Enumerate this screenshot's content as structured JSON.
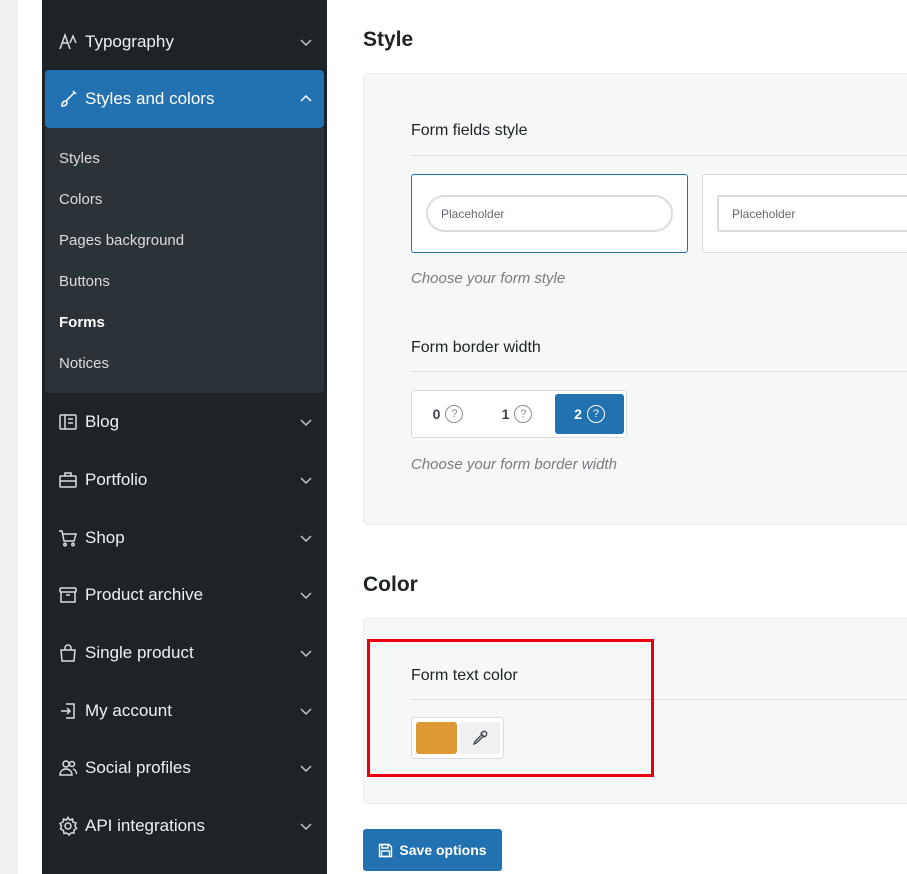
{
  "sidebar": {
    "items": [
      {
        "label": "Typography",
        "icon": "typography-icon"
      },
      {
        "label": "Styles and colors",
        "icon": "brush-icon"
      },
      {
        "label": "Blog",
        "icon": "blog-icon"
      },
      {
        "label": "Portfolio",
        "icon": "briefcase-icon"
      },
      {
        "label": "Shop",
        "icon": "cart-icon"
      },
      {
        "label": "Product archive",
        "icon": "archive-icon"
      },
      {
        "label": "Single product",
        "icon": "bag-icon"
      },
      {
        "label": "My account",
        "icon": "login-icon"
      },
      {
        "label": "Social profiles",
        "icon": "users-icon"
      },
      {
        "label": "API integrations",
        "icon": "gear-icon"
      }
    ],
    "submenu": [
      "Styles",
      "Colors",
      "Pages background",
      "Buttons",
      "Forms",
      "Notices"
    ],
    "current_sub": "Forms"
  },
  "main": {
    "style_section": {
      "title": "Style",
      "fields_style": {
        "label": "Form fields style",
        "placeholder_1": "Placeholder",
        "placeholder_2": "Placeholder",
        "help": "Choose your form style"
      },
      "border_width": {
        "label": "Form border width",
        "options": [
          "0",
          "1",
          "2"
        ],
        "selected": "2",
        "help_icon": "?",
        "help": "Choose your form border width"
      }
    },
    "color_section": {
      "title": "Color",
      "text_color": {
        "label": "Form text color",
        "value": "#dd9933"
      }
    },
    "save_label": "Save options"
  },
  "colors": {
    "accent": "#2271b1",
    "sidebar_bg": "#1d2327",
    "highlight": "#e8000d"
  }
}
